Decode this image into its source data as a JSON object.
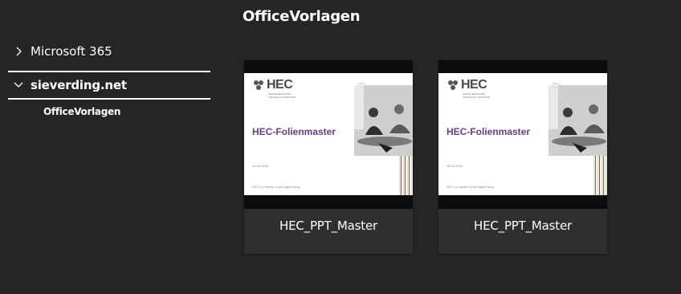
{
  "page": {
    "title": "OfficeVorlagen"
  },
  "nav": {
    "items": [
      {
        "label": "Microsoft 365",
        "expanded": false,
        "icon": "chevron-right-icon"
      },
      {
        "label": "sieverding.net",
        "expanded": true,
        "icon": "chevron-down-icon"
      }
    ],
    "sub_items": [
      {
        "label": "OfficeVorlagen"
      }
    ]
  },
  "cards": [
    {
      "name": "HEC_PPT_Master",
      "thumbnail": {
        "logo": "HEC",
        "tagline": "ECHTE MENSCHEN. VIRTUELLE LÖSUNGEN.",
        "title": "HEC-Folienmaster",
        "top_label": "Folie 1",
        "date": "15.04.2016",
        "footer": "HEC is a member of the Digital Family"
      }
    },
    {
      "name": "HEC_PPT_Master",
      "thumbnail": {
        "logo": "HEC",
        "tagline": "ECHTE MENSCHEN. VIRTUELLE LÖSUNGEN.",
        "title": "HEC-Folienmaster",
        "top_label": "Folie 1",
        "date": "15.04.2016",
        "footer": "HEC is a member of the Digital Family"
      }
    }
  ],
  "colors": {
    "background": "#252525",
    "card": "#2f2f2f",
    "accent_title": "#6a3d8c"
  }
}
